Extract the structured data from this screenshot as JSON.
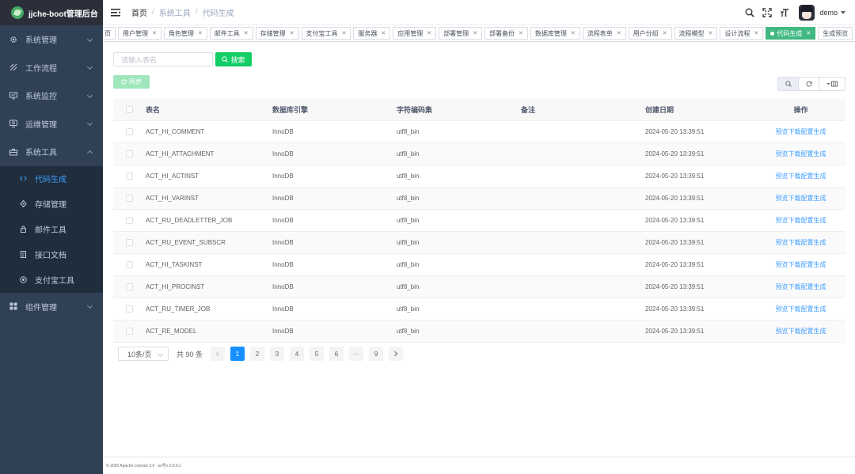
{
  "app": {
    "title": "jjche-boot管理后台"
  },
  "sidebar": {
    "items": [
      {
        "label": "系统管理",
        "icon": "gear-icon",
        "expanded": false
      },
      {
        "label": "工作流程",
        "icon": "workflow-icon",
        "expanded": false
      },
      {
        "label": "系统监控",
        "icon": "monitor-icon",
        "expanded": false
      },
      {
        "label": "运维管理",
        "icon": "ops-icon",
        "expanded": false
      },
      {
        "label": "系统工具",
        "icon": "toolbox-icon",
        "expanded": true
      },
      {
        "label": "组件管理",
        "icon": "grid-icon",
        "expanded": false
      }
    ],
    "subitems": [
      {
        "label": "代码生成",
        "icon": "code-icon",
        "active": true
      },
      {
        "label": "存储管理",
        "icon": "storage-icon",
        "active": false
      },
      {
        "label": "邮件工具",
        "icon": "mail-icon",
        "active": false
      },
      {
        "label": "接口文档",
        "icon": "doc-icon",
        "active": false
      },
      {
        "label": "支付宝工具",
        "icon": "alipay-icon",
        "active": false
      }
    ]
  },
  "header": {
    "breadcrumb": [
      "首页",
      "系统工具",
      "代码生成"
    ],
    "user": "demo"
  },
  "tags": [
    {
      "label": "页",
      "closable": false,
      "active": false
    },
    {
      "label": "用户管理",
      "closable": true,
      "active": false
    },
    {
      "label": "角色管理",
      "closable": true,
      "active": false
    },
    {
      "label": "邮件工具",
      "closable": true,
      "active": false
    },
    {
      "label": "存储管理",
      "closable": true,
      "active": false
    },
    {
      "label": "支付宝工具",
      "closable": true,
      "active": false
    },
    {
      "label": "服务器",
      "closable": true,
      "active": false
    },
    {
      "label": "应用管理",
      "closable": true,
      "active": false
    },
    {
      "label": "部署管理",
      "closable": true,
      "active": false
    },
    {
      "label": "部署备份",
      "closable": true,
      "active": false
    },
    {
      "label": "数据库管理",
      "closable": true,
      "active": false
    },
    {
      "label": "流程表单",
      "closable": true,
      "active": false
    },
    {
      "label": "用户分组",
      "closable": true,
      "active": false
    },
    {
      "label": "流程模型",
      "closable": true,
      "active": false
    },
    {
      "label": "设计流程",
      "closable": true,
      "active": false
    },
    {
      "label": "代码生成",
      "closable": true,
      "active": true
    },
    {
      "label": "生成预览",
      "closable": false,
      "active": false
    }
  ],
  "search": {
    "placeholder": "请输入表名",
    "button": "搜索"
  },
  "sync_button": "同步",
  "table": {
    "headers": [
      "表名",
      "数据库引擎",
      "字符编码集",
      "备注",
      "创建日期",
      "操作"
    ],
    "ops": [
      "预览",
      "下载",
      "配置",
      "生成"
    ],
    "rows": [
      {
        "name": "ACT_HI_COMMENT",
        "engine": "InnoDB",
        "charset": "utf8_bin",
        "remark": "",
        "date": "2024-05-20 13:39:51"
      },
      {
        "name": "ACT_HI_ATTACHMENT",
        "engine": "InnoDB",
        "charset": "utf8_bin",
        "remark": "",
        "date": "2024-05-20 13:39:51"
      },
      {
        "name": "ACT_HI_ACTINST",
        "engine": "InnoDB",
        "charset": "utf8_bin",
        "remark": "",
        "date": "2024-05-20 13:39:51"
      },
      {
        "name": "ACT_HI_VARINST",
        "engine": "InnoDB",
        "charset": "utf8_bin",
        "remark": "",
        "date": "2024-05-20 13:39:51"
      },
      {
        "name": "ACT_RU_DEADLETTER_JOB",
        "engine": "InnoDB",
        "charset": "utf8_bin",
        "remark": "",
        "date": "2024-05-20 13:39:51"
      },
      {
        "name": "ACT_RU_EVENT_SUBSCR",
        "engine": "InnoDB",
        "charset": "utf8_bin",
        "remark": "",
        "date": "2024-05-20 13:39:51"
      },
      {
        "name": "ACT_HI_TASKINST",
        "engine": "InnoDB",
        "charset": "utf8_bin",
        "remark": "",
        "date": "2024-05-20 13:39:51"
      },
      {
        "name": "ACT_HI_PROCINST",
        "engine": "InnoDB",
        "charset": "utf8_bin",
        "remark": "",
        "date": "2024-05-20 13:39:51"
      },
      {
        "name": "ACT_RU_TIMER_JOB",
        "engine": "InnoDB",
        "charset": "utf8_bin",
        "remark": "",
        "date": "2024-05-20 13:39:51"
      },
      {
        "name": "ACT_RE_MODEL",
        "engine": "InnoDB",
        "charset": "utf8_bin",
        "remark": "",
        "date": "2024-05-20 13:39:51"
      }
    ]
  },
  "pagination": {
    "page_size": "10条/页",
    "total": "共 90 条",
    "pages": [
      "1",
      "2",
      "3",
      "4",
      "5",
      "6",
      "···",
      "9"
    ],
    "current": "1"
  },
  "footer": "© 2020 Apache License 2.0 · ss号v 2.0.0.1",
  "colors": {
    "sidebar_bg": "#304156",
    "active_blue": "#409eff",
    "green": "#13ce66",
    "tag_active": "#42b983"
  }
}
